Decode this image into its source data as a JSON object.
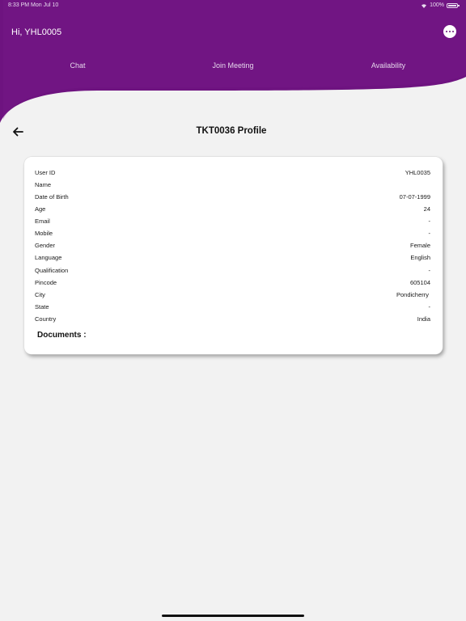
{
  "status_bar": {
    "time": "8:33 PM  Mon Jul 10",
    "battery": "100%"
  },
  "header": {
    "greeting": "Hi, YHL0005",
    "tabs": [
      {
        "label": "Chat"
      },
      {
        "label": "Join Meeting"
      },
      {
        "label": "Availability"
      }
    ]
  },
  "page": {
    "title": "TKT0036 Profile"
  },
  "profile": {
    "fields": [
      {
        "label": "User ID",
        "value": "YHL0035"
      },
      {
        "label": "Name",
        "value": ""
      },
      {
        "label": "Date of Birth",
        "value": "07-07-1999"
      },
      {
        "label": "Age",
        "value": "24"
      },
      {
        "label": "Email",
        "value": "-"
      },
      {
        "label": "Mobile",
        "value": "-"
      },
      {
        "label": "Gender",
        "value": "Female"
      },
      {
        "label": "Language",
        "value": "English"
      },
      {
        "label": "Qualification",
        "value": "-"
      },
      {
        "label": "Pincode",
        "value": "605104"
      },
      {
        "label": "City",
        "value": "Pondicherry"
      },
      {
        "label": "State",
        "value": "-"
      },
      {
        "label": "Country",
        "value": "India"
      }
    ],
    "documents_label": "Documents :"
  },
  "colors": {
    "header_purple": "#6e1380",
    "background": "#f2f2f2"
  }
}
